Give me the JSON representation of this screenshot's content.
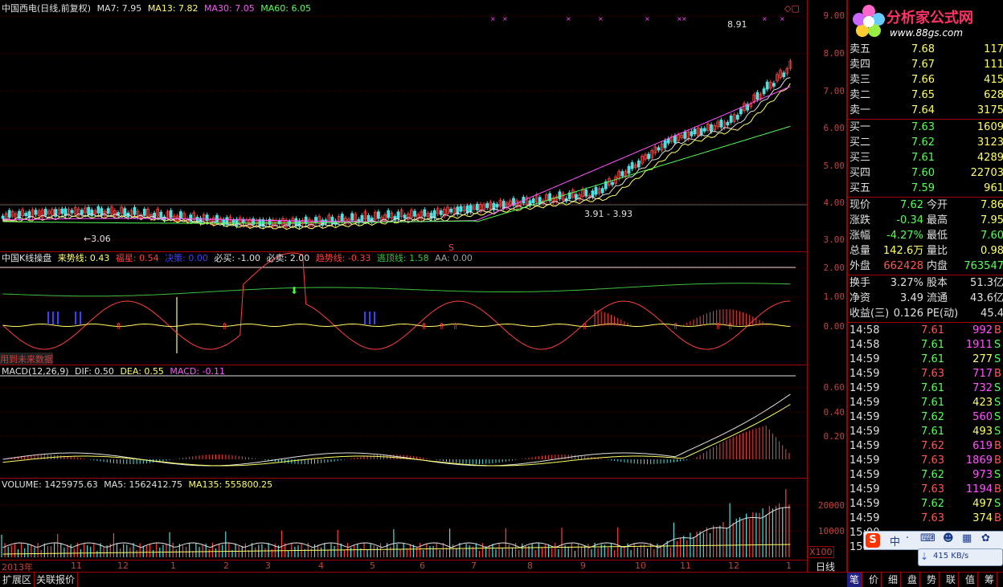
{
  "main": {
    "title": "中国西电(日线,前复权)",
    "ma": [
      {
        "label": "MA7: 7.95",
        "color": "#e0e0e0"
      },
      {
        "label": "MA13: 7.82",
        "color": "#ffff66"
      },
      {
        "label": "MA30: 7.05",
        "color": "#ff55ff"
      },
      {
        "label": "MA60: 6.05",
        "color": "#55ff55"
      }
    ],
    "high_mark": "8.91",
    "low_mark": "3.06",
    "range_mark": "3.91 - 3.93",
    "s_mark": "S",
    "y_labels": [
      "9.00",
      "8.00",
      "7.00",
      "6.00",
      "5.00",
      "4.00",
      "3.00"
    ]
  },
  "indicator": {
    "title": "中国K线操盘",
    "items": [
      {
        "label": "来势线: 0.43",
        "color": "#ffff66"
      },
      {
        "label": "福星: 0.54",
        "color": "#ff4040"
      },
      {
        "label": "决策: 0.00",
        "color": "#4040ff"
      },
      {
        "label": "必买: -1.00",
        "color": "#e0e0e0"
      },
      {
        "label": "必卖: 2.00",
        "color": "#e0e0e0"
      },
      {
        "label": "趋势线: -0.33",
        "color": "#ff4040"
      },
      {
        "label": "逃顶线: 1.58",
        "color": "#40c040"
      },
      {
        "label": "AA: 0.00",
        "color": "#a0a0a0"
      }
    ],
    "note": "用到未来数据",
    "y_labels": [
      "2.00",
      "1.00",
      "0.00"
    ]
  },
  "macd": {
    "title": "MACD(12,26,9)",
    "items": [
      {
        "label": "DIF: 0.50",
        "color": "#e0e0e0"
      },
      {
        "label": "DEA: 0.55",
        "color": "#ffff66"
      },
      {
        "label": "MACD: -0.11",
        "color": "#ff55ff"
      }
    ],
    "y_labels": [
      "0.60",
      "0.40",
      "0.20"
    ]
  },
  "volume": {
    "items": [
      {
        "label": "VOLUME: 1425975.63",
        "color": "#e0e0e0"
      },
      {
        "label": "MA5: 1562412.75",
        "color": "#e0e0e0"
      },
      {
        "label": "MA135: 555800.25",
        "color": "#ffff66"
      }
    ],
    "y_labels": [
      "20000",
      "10000"
    ],
    "multiplier": "X100"
  },
  "x_labels": [
    "2013年",
    "11",
    "12",
    "1",
    "2",
    "3",
    "4",
    "5",
    "6",
    "7",
    "8",
    "9",
    "10",
    "11",
    "12",
    "1"
  ],
  "period": "日线",
  "bottom_tabs": [
    "扩展区",
    "关联报价"
  ],
  "side_tabs": [
    "笔",
    "价",
    "细",
    "盘",
    "势",
    "联",
    "值",
    "筹"
  ],
  "logo": {
    "name": "分析家公式网",
    "url": "www.88gs.com"
  },
  "quotes": {
    "sell": [
      {
        "label": "卖五",
        "price": "7.68",
        "vol": "117"
      },
      {
        "label": "卖四",
        "price": "7.67",
        "vol": "111"
      },
      {
        "label": "卖三",
        "price": "7.66",
        "vol": "415"
      },
      {
        "label": "卖二",
        "price": "7.65",
        "vol": "628"
      },
      {
        "label": "卖一",
        "price": "7.64",
        "vol": "3175"
      }
    ],
    "buy": [
      {
        "label": "买一",
        "price": "7.63",
        "vol": "1609"
      },
      {
        "label": "买二",
        "price": "7.62",
        "vol": "3123"
      },
      {
        "label": "买三",
        "price": "7.61",
        "vol": "4289"
      },
      {
        "label": "买四",
        "price": "7.60",
        "vol": "22703"
      },
      {
        "label": "买五",
        "price": "7.59",
        "vol": "961"
      }
    ],
    "stats": [
      {
        "l1": "现价",
        "v1": "7.62",
        "l2": "今开",
        "v2": "7.86"
      },
      {
        "l1": "涨跌",
        "v1": "-0.34",
        "l2": "最高",
        "v2": "7.95"
      },
      {
        "l1": "涨幅",
        "v1": "-4.27%",
        "l2": "最低",
        "v2": "7.60"
      },
      {
        "l1": "总量",
        "v1": "142.6万",
        "l2": "量比",
        "v2": "0.98"
      },
      {
        "l1": "外盘",
        "v1": "662428",
        "l2": "内盘",
        "v2": "763547"
      }
    ],
    "stats2": [
      {
        "l1": "换手",
        "v1": "3.27%",
        "l2": "股本",
        "v2": "51.3亿"
      },
      {
        "l1": "净资",
        "v1": "3.49",
        "l2": "流通",
        "v2": "43.6亿"
      },
      {
        "l1": "收益(三)",
        "v1": "0.126",
        "l2": "PE(动)",
        "v2": "45.4"
      }
    ]
  },
  "ticks": [
    {
      "t": "14:58",
      "p": "7.61",
      "v": "992",
      "d": "B",
      "c": "#ff5555",
      "vc": "#ff55ff"
    },
    {
      "t": "14:58",
      "p": "7.61",
      "v": "1911",
      "d": "S",
      "c": "#55ff55",
      "vc": "#ff55ff"
    },
    {
      "t": "14:59",
      "p": "7.61",
      "v": "277",
      "d": "S",
      "c": "#55ff55",
      "vc": "#ffff66"
    },
    {
      "t": "14:59",
      "p": "7.63",
      "v": "717",
      "d": "B",
      "c": "#ff5555",
      "vc": "#ff55ff"
    },
    {
      "t": "14:59",
      "p": "7.61",
      "v": "732",
      "d": "S",
      "c": "#55ff55",
      "vc": "#ff55ff"
    },
    {
      "t": "14:59",
      "p": "7.61",
      "v": "423",
      "d": "S",
      "c": "#55ff55",
      "vc": "#ffff66"
    },
    {
      "t": "14:59",
      "p": "7.62",
      "v": "560",
      "d": "S",
      "c": "#55ff55",
      "vc": "#ff55ff"
    },
    {
      "t": "14:59",
      "p": "7.61",
      "v": "493",
      "d": "S",
      "c": "#55ff55",
      "vc": "#ffff66"
    },
    {
      "t": "14:59",
      "p": "7.62",
      "v": "619",
      "d": "B",
      "c": "#ff5555",
      "vc": "#ff55ff"
    },
    {
      "t": "14:59",
      "p": "7.63",
      "v": "1869",
      "d": "B",
      "c": "#ff5555",
      "vc": "#ff55ff"
    },
    {
      "t": "14:59",
      "p": "7.62",
      "v": "973",
      "d": "S",
      "c": "#55ff55",
      "vc": "#ff55ff"
    },
    {
      "t": "14:59",
      "p": "7.63",
      "v": "1194",
      "d": "B",
      "c": "#ff5555",
      "vc": "#ff55ff"
    },
    {
      "t": "14:59",
      "p": "7.62",
      "v": "497",
      "d": "S",
      "c": "#55ff55",
      "vc": "#ffff66"
    },
    {
      "t": "14:59",
      "p": "7.63",
      "v": "374",
      "d": "B",
      "c": "#ff5555",
      "vc": "#ffff66"
    },
    {
      "t": "15:00",
      "p": "",
      "v": "",
      "d": "",
      "c": "#e0e0e0",
      "vc": "#e0e0e0"
    },
    {
      "t": "15:00",
      "p": "",
      "v": "",
      "d": "",
      "c": "#e0e0e0",
      "vc": "#e0e0e0"
    }
  ],
  "ime": {
    "label": "中",
    "speed": "415 KB/s"
  }
}
